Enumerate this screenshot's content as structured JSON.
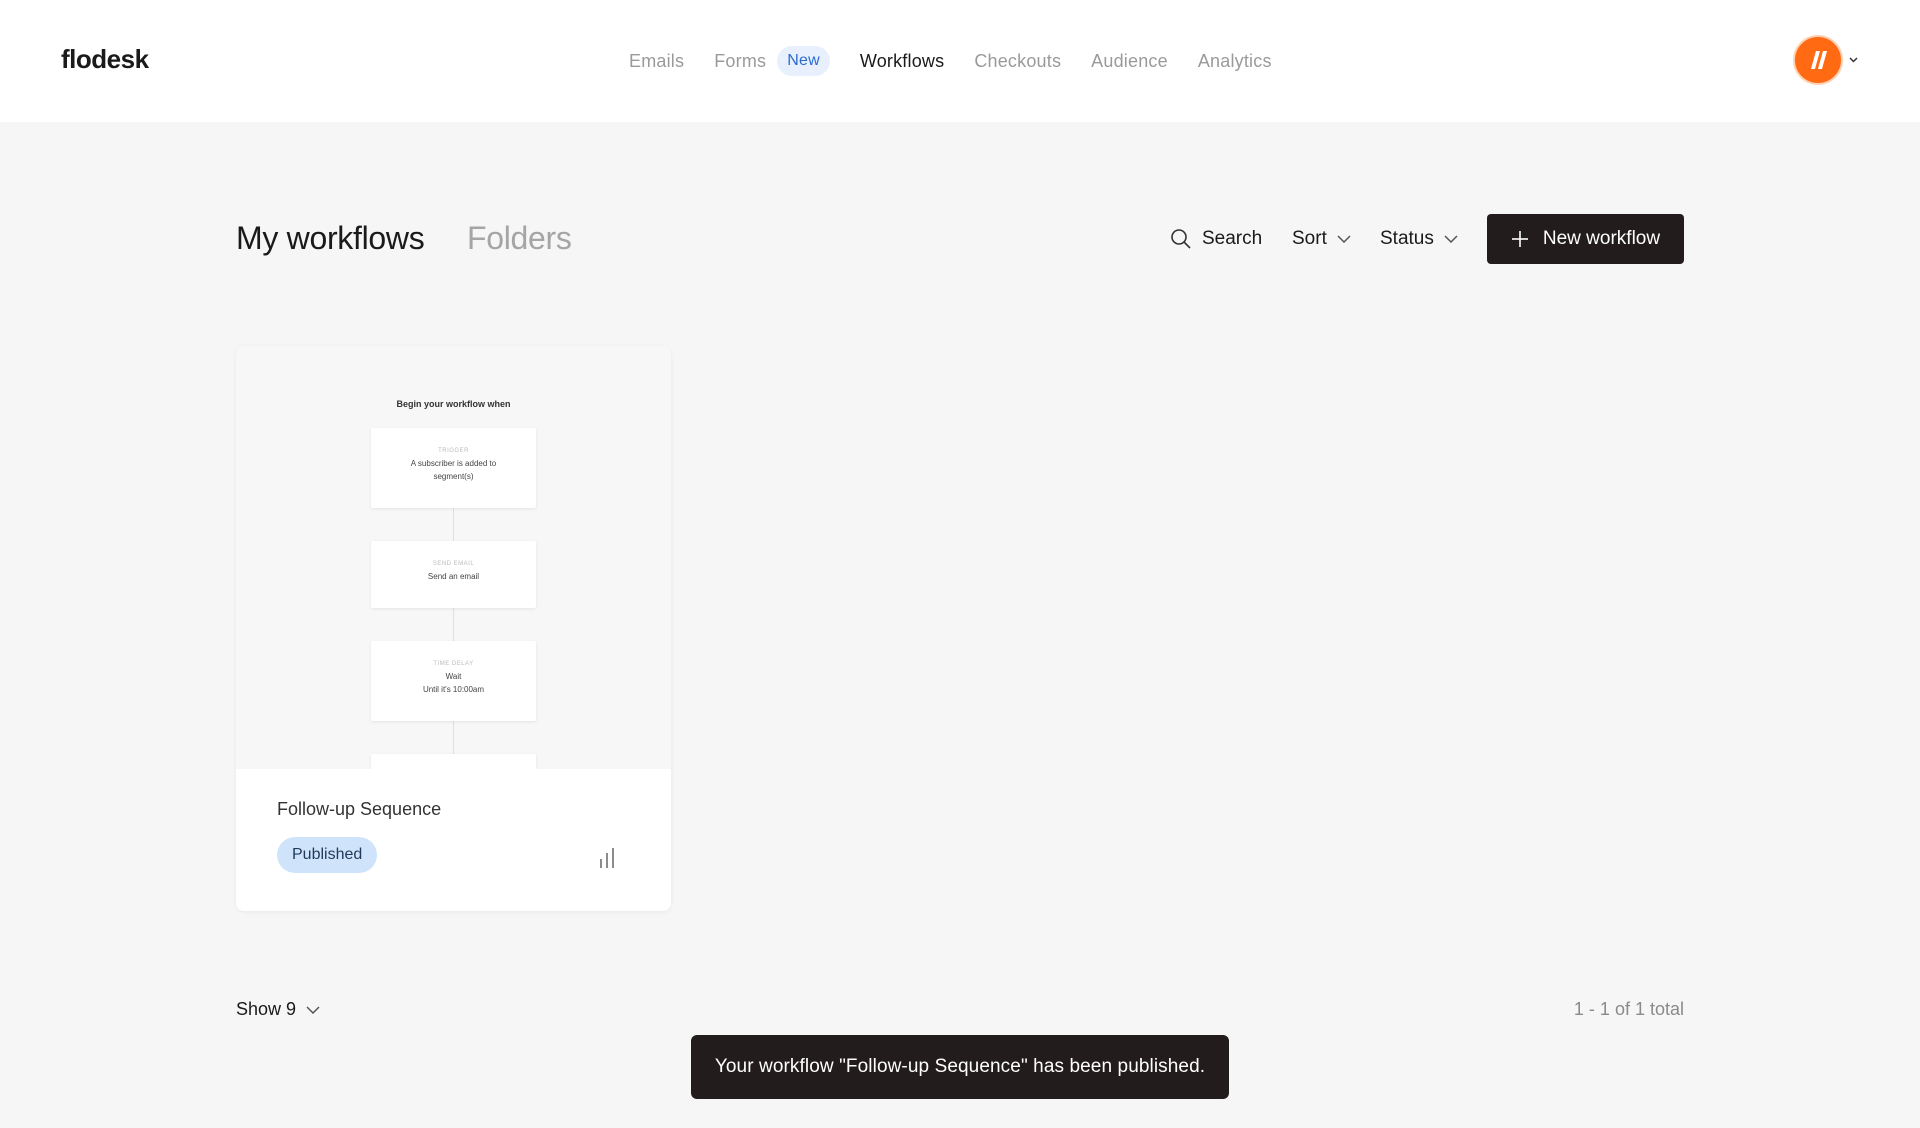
{
  "app": {
    "logo": "flodesk"
  },
  "nav": {
    "items": [
      {
        "label": "Emails"
      },
      {
        "label": "Forms",
        "badge": "New"
      },
      {
        "label": "Workflows",
        "active": true
      },
      {
        "label": "Checkouts"
      },
      {
        "label": "Audience"
      },
      {
        "label": "Analytics"
      }
    ]
  },
  "page": {
    "tabs": {
      "active": "My workflows",
      "other": "Folders"
    },
    "toolbar": {
      "search": "Search",
      "sort": "Sort",
      "status": "Status",
      "new_button": "New workflow"
    }
  },
  "workflows": [
    {
      "name": "Follow-up Sequence",
      "status": "Published",
      "preview": {
        "heading": "Begin your workflow when",
        "nodes": [
          {
            "type": "Trigger",
            "desc_1": "A subscriber is added to",
            "desc_2": "segment(s)"
          },
          {
            "type": "Send email",
            "desc_1": "Send an email"
          },
          {
            "type": "Time delay",
            "desc_1": "Wait",
            "desc_2": "Until it's 10:00am"
          }
        ]
      }
    }
  ],
  "footer": {
    "show": "Show 9",
    "pagination": "1 - 1 of 1 total"
  },
  "toast": {
    "message": "Your workflow \"Follow-up Sequence\" has been published."
  },
  "colors": {
    "accent_dark": "#231c1c",
    "avatar": "#ff6a13",
    "badge_bg": "#e7f0fc",
    "status_bg": "#cfe4fb"
  },
  "icons": {
    "search": "search-icon",
    "chevron": "chevron-down-icon",
    "plus": "plus-icon",
    "analytics": "bar-chart-icon",
    "avatar": "brand-avatar-icon"
  }
}
